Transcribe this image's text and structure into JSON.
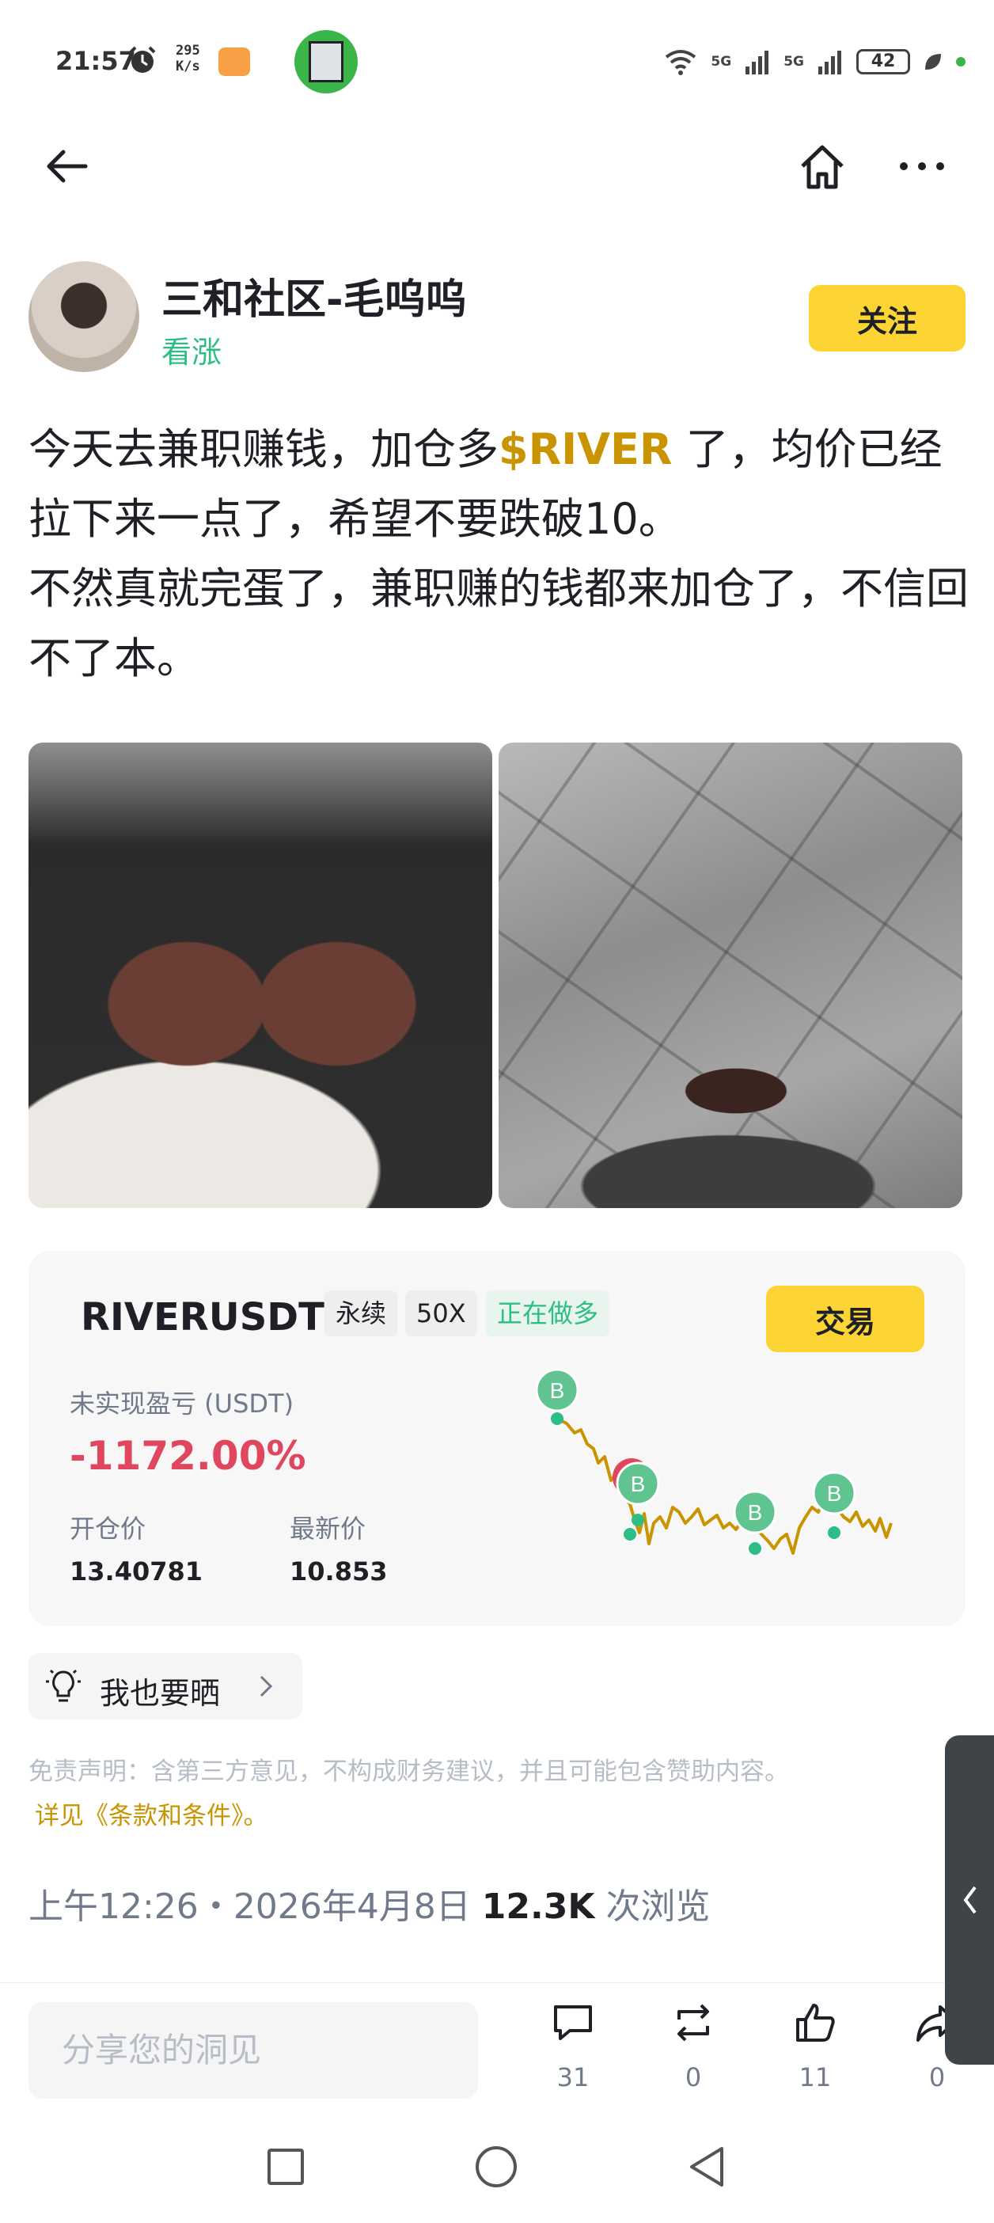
{
  "status_bar": {
    "time": "21:57",
    "speed": "295\nK/s",
    "network_1": "5G",
    "network_2": "5G",
    "battery": "42"
  },
  "author": {
    "name": "三和社区-毛呜呜",
    "tag": "看涨",
    "follow_label": "关注"
  },
  "post": {
    "text_before_ticker": "今天去兼职赚钱，加仓多",
    "ticker": "$RIVER",
    "text_after_ticker": " 了，均价已经拉下来一点了，希望不要跌破10。",
    "text_line_2": "不然真就完蛋了，兼职赚的钱都来加仓了，不信回不了本。"
  },
  "trade_card": {
    "symbol": "RIVERUSDT",
    "tag_perpetual": "永续",
    "tag_leverage": "50X",
    "tag_position": "正在做多",
    "trade_label": "交易",
    "pnl_label": "未实现盈亏 (USDT)",
    "pnl_value": "-1172.00%",
    "entry_label": "开仓价",
    "entry_value": "13.40781",
    "last_label": "最新价",
    "last_value": "10.853",
    "marker_letter": "B",
    "colors": {
      "up": "#2ebd85",
      "down": "#e0465e",
      "line": "#c99400"
    }
  },
  "share": {
    "label": "我也要晒"
  },
  "disclaimer": {
    "text": "免责声明：含第三方意见，不构成财务建议，并且可能包含赞助内容。",
    "terms_link": "详见《条款和条件》。"
  },
  "meta": {
    "time": "上午12:26",
    "separator": "・",
    "date": "2026年4月8日",
    "views_count": "12.3K",
    "views_label": "次浏览"
  },
  "bottom_bar": {
    "comment_placeholder": "分享您的洞见",
    "comments": "31",
    "reposts": "0",
    "likes": "11",
    "shares": "0"
  },
  "icons": [
    "back-icon",
    "home-icon",
    "more-icon",
    "bulb-icon",
    "chevron-right-icon",
    "comment-icon",
    "repost-icon",
    "like-icon",
    "share-icon",
    "chevron-left-icon"
  ]
}
